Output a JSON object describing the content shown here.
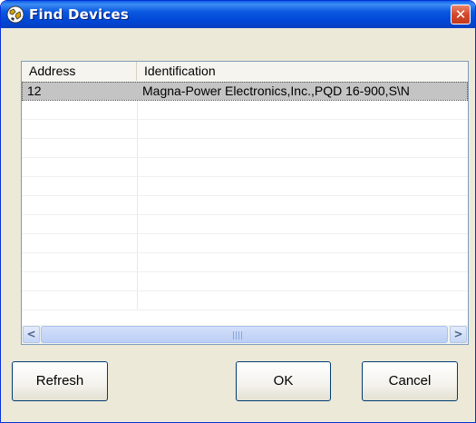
{
  "window": {
    "title": "Find Devices",
    "close_glyph": "✕"
  },
  "icons": {
    "app": "devices-globe-icon",
    "close": "close-icon",
    "scroll_left": "chevron-left-icon",
    "scroll_right": "chevron-right-icon"
  },
  "list": {
    "columns": [
      "Address",
      "Identification"
    ],
    "rows": [
      {
        "address": "12",
        "identification": "Magna-Power Electronics,Inc.,PQD 16-900,S\\N",
        "selected": true
      }
    ],
    "empty_row_count": 11
  },
  "scrollbar": {
    "left_glyph": "<",
    "right_glyph": ">"
  },
  "buttons": {
    "refresh": "Refresh",
    "ok": "OK",
    "cancel": "Cancel"
  },
  "colors": {
    "title_bar": "#0a58e0",
    "close_button": "#d4482a",
    "selection": "#c4c4c4",
    "dialog_bg": "#ece9d8"
  }
}
